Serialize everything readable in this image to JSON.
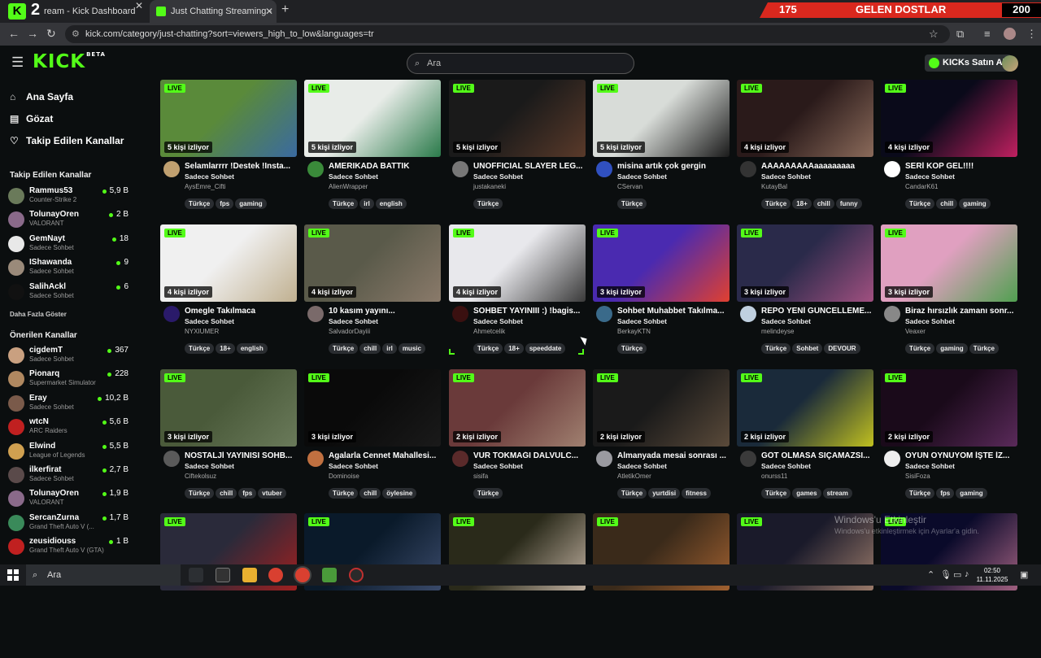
{
  "browser": {
    "tabs": [
      {
        "label": "ream - Kick Dashboard"
      },
      {
        "label": "Just Chatting Streaming - Live S"
      }
    ],
    "kick_badge_number": "2",
    "url": "kick.com/category/just-chatting?sort=viewers_high_to_low&languages=tr",
    "banner": {
      "left": "175",
      "middle": "GELEN DOSTLAR",
      "right": "200"
    }
  },
  "header": {
    "logo": "KICK",
    "logo_badge": "BETA",
    "search_placeholder": "Ara",
    "buy_kicks_label": "KICKs Satın Al"
  },
  "sidebar": {
    "nav": [
      {
        "label": "Ana Sayfa",
        "icon": "home-icon"
      },
      {
        "label": "Gözat",
        "icon": "browse-icon"
      },
      {
        "label": "Takip Edilen Kanallar",
        "icon": "heart-icon"
      }
    ],
    "followed_heading": "Takip Edilen Kanallar",
    "followed": [
      {
        "name": "Rammus53",
        "sub": "Counter-Strike 2",
        "viewers": "5,9 B",
        "color": "#6a7a5a"
      },
      {
        "name": "TolunayOren",
        "sub": "VALORANT",
        "viewers": "2 B",
        "color": "#8a6a8a"
      },
      {
        "name": "GemNayt",
        "sub": "Sadece Sohbet",
        "viewers": "18",
        "color": "#e8e8e8"
      },
      {
        "name": "IShawanda",
        "sub": "Sadece Sohbet",
        "viewers": "9",
        "color": "#9a8a7a"
      },
      {
        "name": "SalihAckl",
        "sub": "Sadece Sohbet",
        "viewers": "6",
        "color": "#111111"
      }
    ],
    "show_more_label": "Daha Fazla Göster",
    "recommended_heading": "Önerilen Kanallar",
    "recommended": [
      {
        "name": "cigdemT",
        "sub": "Sadece Sohbet",
        "viewers": "367",
        "color": "#c9a080"
      },
      {
        "name": "Pionarq",
        "sub": "Supermarket Simulator",
        "viewers": "228",
        "color": "#b08860"
      },
      {
        "name": "Eray",
        "sub": "Sadece Sohbet",
        "viewers": "10,2 B",
        "color": "#7a5a4a"
      },
      {
        "name": "wtcN",
        "sub": "ARC Raiders",
        "viewers": "5,6 B",
        "color": "#c02020"
      },
      {
        "name": "Elwind",
        "sub": "League of Legends",
        "viewers": "5,5 B",
        "color": "#d0a050"
      },
      {
        "name": "ilkerfirat",
        "sub": "Sadece Sohbet",
        "viewers": "2,7 B",
        "color": "#5a4a4a"
      },
      {
        "name": "TolunayOren",
        "sub": "VALORANT",
        "viewers": "1,9 B",
        "color": "#8a6a8a"
      },
      {
        "name": "SercanZurna",
        "sub": "Grand Theft Auto V (...",
        "viewers": "1,7 B",
        "color": "#3a8a5a"
      },
      {
        "name": "zeusidiouss",
        "sub": "Grand Theft Auto V (GTA)",
        "viewers": "1 B",
        "color": "#c02020"
      }
    ]
  },
  "grid": {
    "live_label": "LIVE",
    "streams": [
      {
        "title": "Selamlarrrr !Destek !Insta...",
        "category": "Sadece Sohbet",
        "channel": "AysEmre_Cifti",
        "viewers": "5 kişi izliyor",
        "tags": [
          "Türkçe",
          "fps",
          "gaming"
        ],
        "thumb": "#5a8a3a",
        "thumb2": "#3a6aa0",
        "av": "#c0a070"
      },
      {
        "title": "AMERIKADA BATTIK",
        "category": "Sadece Sohbet",
        "channel": "AlienWrapper",
        "viewers": "5 kişi izliyor",
        "tags": [
          "Türkçe",
          "irl",
          "english"
        ],
        "thumb": "#e8ece8",
        "thumb2": "#2a7a4a",
        "av": "#3a8a3a"
      },
      {
        "title": "UNOFFICIAL SLAYER LEG...",
        "category": "Sadece Sohbet",
        "channel": "justakaneki",
        "viewers": "5 kişi izliyor",
        "tags": [
          "Türkçe"
        ],
        "thumb": "#1a1a1a",
        "thumb2": "#5a3a2a",
        "av": "#777777"
      },
      {
        "title": "misina artık çok gergin",
        "category": "Sadece Sohbet",
        "channel": "CServan",
        "viewers": "5 kişi izliyor",
        "tags": [
          "Türkçe"
        ],
        "thumb": "#d8dcd8",
        "thumb2": "#1a1a1a",
        "av": "#3050c0"
      },
      {
        "title": "AAAAAAAAAaaaaaaaaa",
        "category": "Sadece Sohbet",
        "channel": "KutayBal",
        "viewers": "4 kişi izliyor",
        "tags": [
          "Türkçe",
          "18+",
          "chill",
          "funny"
        ],
        "thumb": "#2a1a1a",
        "thumb2": "#8a6a5a",
        "av": "#333333"
      },
      {
        "title": "SERİ KOP GEL!!!!",
        "category": "Sadece Sohbet",
        "channel": "CandarK61",
        "viewers": "4 kişi izliyor",
        "tags": [
          "Türkçe",
          "chill",
          "gaming"
        ],
        "thumb": "#0a0a1a",
        "thumb2": "#c02060",
        "av": "#ffffff"
      },
      {
        "title": "Omegle Takılmaca",
        "category": "Sadece Sohbet",
        "channel": "NYXIUMER",
        "viewers": "4 kişi izliyor",
        "tags": [
          "Türkçe",
          "18+",
          "english"
        ],
        "thumb": "#f0f0f0",
        "thumb2": "#c0b090",
        "av": "#2a1a6a"
      },
      {
        "title": "10 kasım yayını...",
        "category": "Sadece Sohbet",
        "channel": "SalvadorDayiii",
        "viewers": "4 kişi izliyor",
        "tags": [
          "Türkçe",
          "chill",
          "irl",
          "music"
        ],
        "thumb": "#5a5a4a",
        "thumb2": "#8a7a6a",
        "av": "#7a6a6a"
      },
      {
        "title": "SOHBET YAYINIII :) !bagis...",
        "category": "Sadece Sohbet",
        "channel": "Ahmetcelik",
        "viewers": "4 kişi izliyor",
        "tags": [
          "Türkçe",
          "18+",
          "speeddate"
        ],
        "thumb": "#e8e8ec",
        "thumb2": "#3a3a3a",
        "av": "#3a1010"
      },
      {
        "title": "Sohbet Muhabbet Takılma...",
        "category": "Sadece Sohbet",
        "channel": "BerkayKTN",
        "viewers": "3 kişi izliyor",
        "tags": [
          "Türkçe"
        ],
        "thumb": "#4a2ab0",
        "thumb2": "#e04030",
        "av": "#3a6a8a"
      },
      {
        "title": "REPO YENİ GÜNCELLEME...",
        "category": "Sadece Sohbet",
        "channel": "melindeyse",
        "viewers": "3 kişi izliyor",
        "tags": [
          "Türkçe",
          "Sohbet",
          "DEVOUR"
        ],
        "thumb": "#2a2a4a",
        "thumb2": "#a05080",
        "av": "#c0d0e0"
      },
      {
        "title": "Biraz hırsızlık zamanı sonr...",
        "category": "Sadece Sohbet",
        "channel": "Veaxer",
        "viewers": "3 kişi izliyor",
        "tags": [
          "Türkçe",
          "gaming",
          "Türkçe"
        ],
        "thumb": "#e0a0c0",
        "thumb2": "#50a050",
        "av": "#888888"
      },
      {
        "title": "NOSTALJİ YAYINISI SOHB...",
        "category": "Sadece Sohbet",
        "channel": "Ciftekolsuz",
        "viewers": "3 kişi izliyor",
        "tags": [
          "Türkçe",
          "chill",
          "fps",
          "vtuber"
        ],
        "thumb": "#4a5a3a",
        "thumb2": "#6a7a5a",
        "av": "#5a5a5a"
      },
      {
        "title": "Agalarla Cennet Mahallesi...",
        "category": "Sadece Sohbet",
        "channel": "Dominoise",
        "viewers": "3 kişi izliyor",
        "tags": [
          "Türkçe",
          "chill",
          "öylesine"
        ],
        "thumb": "#0a0a0a",
        "thumb2": "#1a1a1a",
        "av": "#c07040"
      },
      {
        "title": "VUR TOKMAĞI DALVULC...",
        "category": "Sadece Sohbet",
        "channel": "sisifa",
        "viewers": "2 kişi izliyor",
        "tags": [
          "Türkçe"
        ],
        "thumb": "#6a3a3a",
        "thumb2": "#a08070",
        "av": "#5a2a2a"
      },
      {
        "title": "Almanyada mesai sonrası ...",
        "category": "Sadece Sohbet",
        "channel": "AtletikOmer",
        "viewers": "2 kişi izliyor",
        "tags": [
          "Türkçe",
          "yurtdisi",
          "fitness"
        ],
        "thumb": "#1a1a1a",
        "thumb2": "#5a4a3a",
        "av": "#9a9aa0"
      },
      {
        "title": "GÖT OLMASA SIÇAMAZSI...",
        "category": "Sadece Sohbet",
        "channel": "onurss11",
        "viewers": "2 kişi izliyor",
        "tags": [
          "Türkçe",
          "games",
          "stream"
        ],
        "thumb": "#1a2a3a",
        "thumb2": "#c0c020",
        "av": "#3a3a3a"
      },
      {
        "title": "OYUN OYNUYOM İŞTE İZ...",
        "category": "Sadece Sohbet",
        "channel": "SisiFoza",
        "viewers": "2 kişi izliyor",
        "tags": [
          "Türkçe",
          "fps",
          "gaming"
        ],
        "thumb": "#1a0a1a",
        "thumb2": "#5a2a5a",
        "av": "#eeeeee"
      },
      {
        "thumb": "#2a2a3a",
        "thumb2": "#a02020"
      },
      {
        "thumb": "#0a1a2a",
        "thumb2": "#3a4a6a"
      },
      {
        "thumb": "#2a2a1a",
        "thumb2": "#c0b0a0"
      },
      {
        "thumb": "#3a2a1a",
        "thumb2": "#a06030"
      },
      {
        "thumb": "#1a1a2a",
        "thumb2": "#9a7a6a"
      },
      {
        "thumb": "#0a0a2a",
        "thumb2": "#a06080"
      }
    ]
  },
  "watermark": {
    "line1": "Windows'u Etkinleştir",
    "line2": "Windows'u etkinleştirmek için Ayarlar'a gidin."
  },
  "taskbar": {
    "search_label": "Ara",
    "time": "02:50",
    "date": "11.11.2025"
  }
}
